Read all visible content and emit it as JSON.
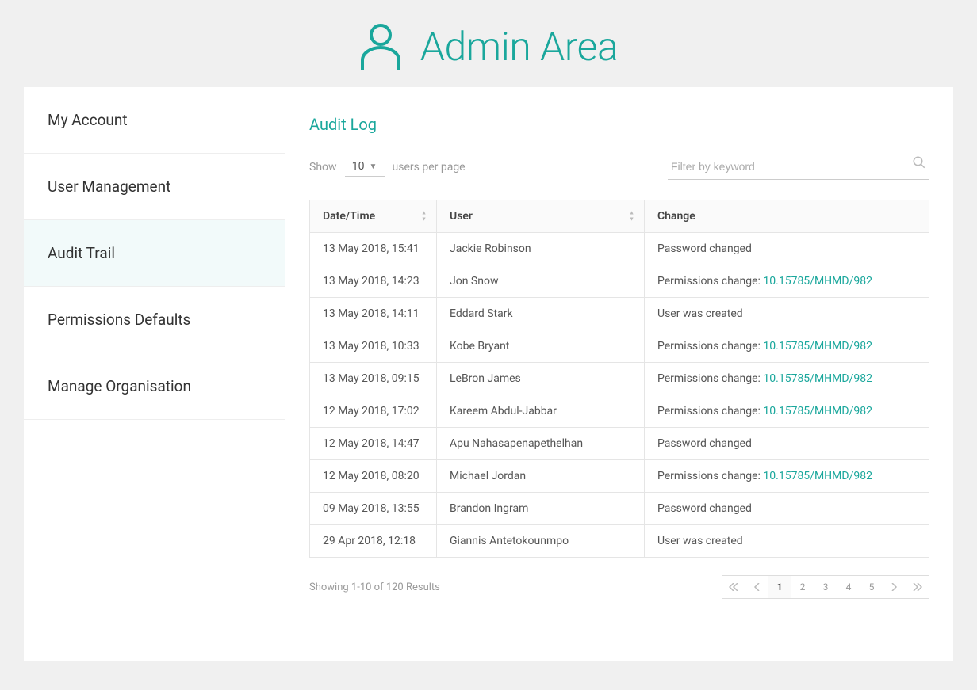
{
  "header": {
    "title": "Admin Area"
  },
  "sidebar": {
    "items": [
      {
        "label": "My Account"
      },
      {
        "label": "User Management"
      },
      {
        "label": "Audit Trail"
      },
      {
        "label": "Permissions Defaults"
      },
      {
        "label": "Manage Organisation"
      }
    ],
    "active_index": 2
  },
  "page": {
    "title": "Audit Log",
    "show_label": "Show",
    "page_size": "10",
    "per_page_label": "users per page",
    "search_placeholder": "Filter by keyword"
  },
  "table": {
    "columns": {
      "datetime": "Date/Time",
      "user": "User",
      "change": "Change"
    },
    "permissions_prefix": "Permissions change: ",
    "rows": [
      {
        "datetime": "13 May 2018, 15:41",
        "user": "Jackie Robinson",
        "change_text": "Password changed",
        "link": null
      },
      {
        "datetime": "13 May 2018, 14:23",
        "user": "Jon Snow",
        "change_text": null,
        "link": "10.15785/MHMD/982"
      },
      {
        "datetime": "13 May 2018, 14:11",
        "user": "Eddard Stark",
        "change_text": "User was created",
        "link": null
      },
      {
        "datetime": "13 May 2018, 10:33",
        "user": "Kobe Bryant",
        "change_text": null,
        "link": "10.15785/MHMD/982"
      },
      {
        "datetime": "13 May 2018, 09:15",
        "user": "LeBron James",
        "change_text": null,
        "link": "10.15785/MHMD/982"
      },
      {
        "datetime": "12 May 2018, 17:02",
        "user": "Kareem Abdul-Jabbar",
        "change_text": null,
        "link": "10.15785/MHMD/982"
      },
      {
        "datetime": "12 May 2018, 14:47",
        "user": "Apu Nahasapenapethelhan",
        "change_text": "Password changed",
        "link": null
      },
      {
        "datetime": "12 May 2018, 08:20",
        "user": "Michael Jordan",
        "change_text": null,
        "link": "10.15785/MHMD/982"
      },
      {
        "datetime": "09 May 2018, 13:55",
        "user": "Brandon Ingram",
        "change_text": "Password changed",
        "link": null
      },
      {
        "datetime": "29 Apr 2018, 12:18",
        "user": "Giannis Antetokounmpo",
        "change_text": "User was created",
        "link": null
      }
    ]
  },
  "footer": {
    "summary": "Showing 1-10 of 120 Results",
    "pages": [
      "1",
      "2",
      "3",
      "4",
      "5"
    ],
    "current_page": "1"
  }
}
